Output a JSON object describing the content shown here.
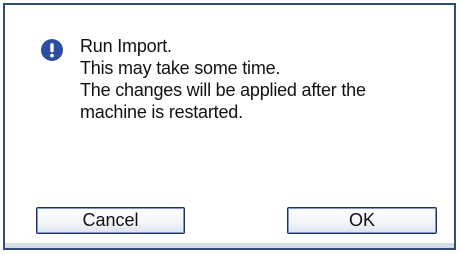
{
  "dialog": {
    "icon": "exclamation-circle-icon",
    "accent_color": "#2c4fa3",
    "border_color": "#2f4e7c",
    "message_lines": [
      "Run Import.",
      "This may take some time.",
      "The changes will be applied after the",
      "machine is restarted."
    ],
    "buttons": {
      "cancel_label": "Cancel",
      "ok_label": "OK"
    }
  }
}
